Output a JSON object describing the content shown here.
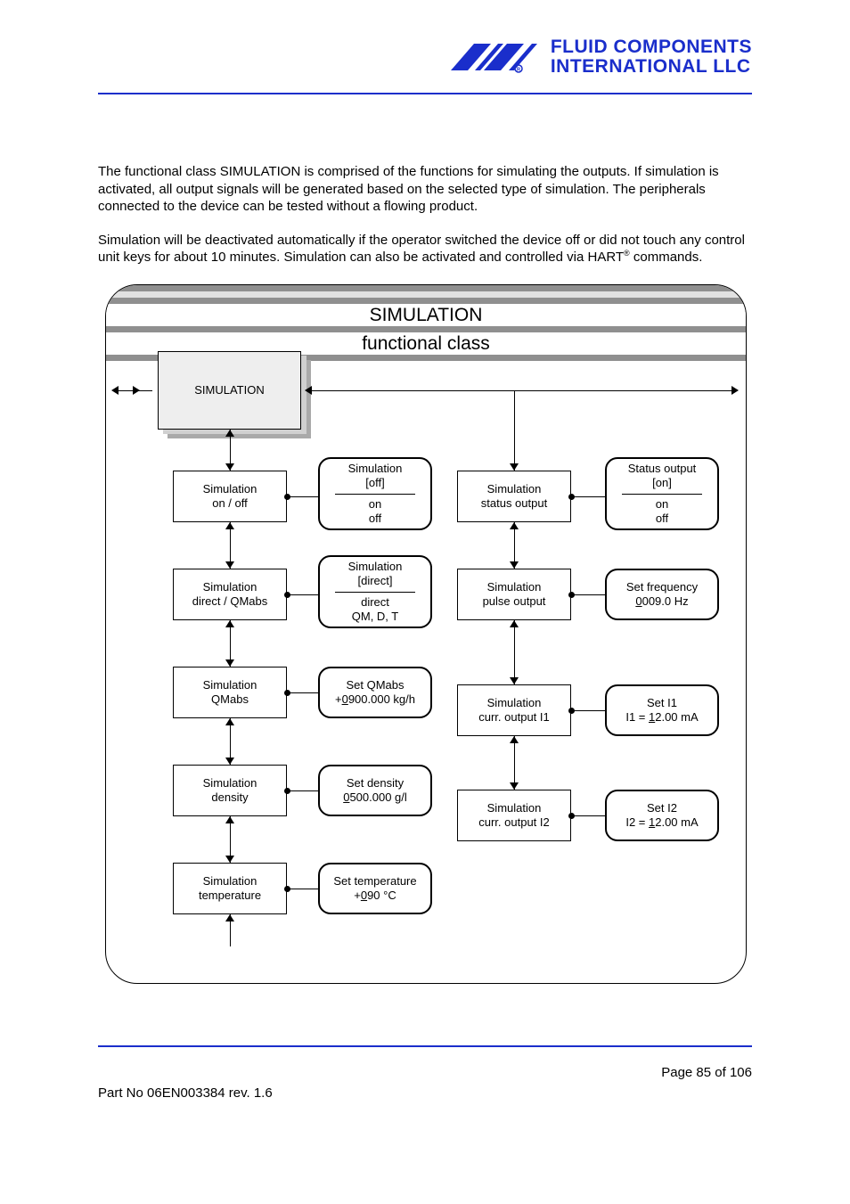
{
  "logo": {
    "line1": "FLUID COMPONENTS",
    "line2": "INTERNATIONAL LLC"
  },
  "paragraphs": {
    "p1": "The functional class SIMULATION is comprised of the functions for simulating the outputs. If simulation is activated, all output signals will be generated based on the selected type of simulation. The peripherals connected to the device can be tested without a flowing product.",
    "p2a": "Simulation will be deactivated automatically if the operator switched the device off or did not touch any control unit keys for about 10 minutes. Simulation can also be activated and controlled via HART",
    "p2b": " commands."
  },
  "diagram": {
    "title": "SIMULATION",
    "subtitle": "functional class",
    "main_box": "SIMULATION",
    "left_col": {
      "r1": {
        "l1": "Simulation",
        "l2": "on / off"
      },
      "r2": {
        "l1": "Simulation",
        "l2": "direct / QMabs"
      },
      "r3": {
        "l1": "Simulation",
        "l2": "QMabs"
      },
      "r4": {
        "l1": "Simulation",
        "l2": "density"
      },
      "r5": {
        "l1": "Simulation",
        "l2": "temperature"
      }
    },
    "left_round": {
      "r1": {
        "top1": "Simulation",
        "top2": "[off]",
        "bot1": "on",
        "bot2": "off"
      },
      "r2": {
        "top1": "Simulation",
        "top2": "[direct]",
        "bot1": "direct",
        "bot2": "QM, D, T"
      },
      "r3": {
        "l1": "Set QMabs",
        "l2_pre": "+",
        "l2_u": "0",
        "l2_post": "900.000 kg/h"
      },
      "r4": {
        "l1": "Set density",
        "l2_u": "0",
        "l2_post": "500.000 g/l"
      },
      "r5": {
        "l1": "Set temperature",
        "l2_pre": "+",
        "l2_u": "0",
        "l2_post": "90 °C"
      }
    },
    "right_rect": {
      "r1": {
        "l1": "Simulation",
        "l2": "status output"
      },
      "r2": {
        "l1": "Simulation",
        "l2": "pulse output"
      },
      "r3": {
        "l1": "Simulation",
        "l2": "curr. output  I1"
      },
      "r4": {
        "l1": "Simulation",
        "l2": "curr. output  I2"
      }
    },
    "right_round": {
      "r1": {
        "top1": "Status output",
        "top2": "[on]",
        "bot1": "on",
        "bot2": "off"
      },
      "r2": {
        "l1": "Set frequency",
        "l2_u": "0",
        "l2_post": "009.0 Hz"
      },
      "r3": {
        "l1": "Set I1",
        "l2_pre": "I1 = ",
        "l2_u": "1",
        "l2_post": "2.00 mA"
      },
      "r4": {
        "l1": "Set I2",
        "l2_pre": "I2 = ",
        "l2_u": "1",
        "l2_post": "2.00 mA"
      }
    }
  },
  "footer": {
    "page": "Page 85 of 106",
    "part": "Part No 06EN003384 rev. 1.6"
  }
}
